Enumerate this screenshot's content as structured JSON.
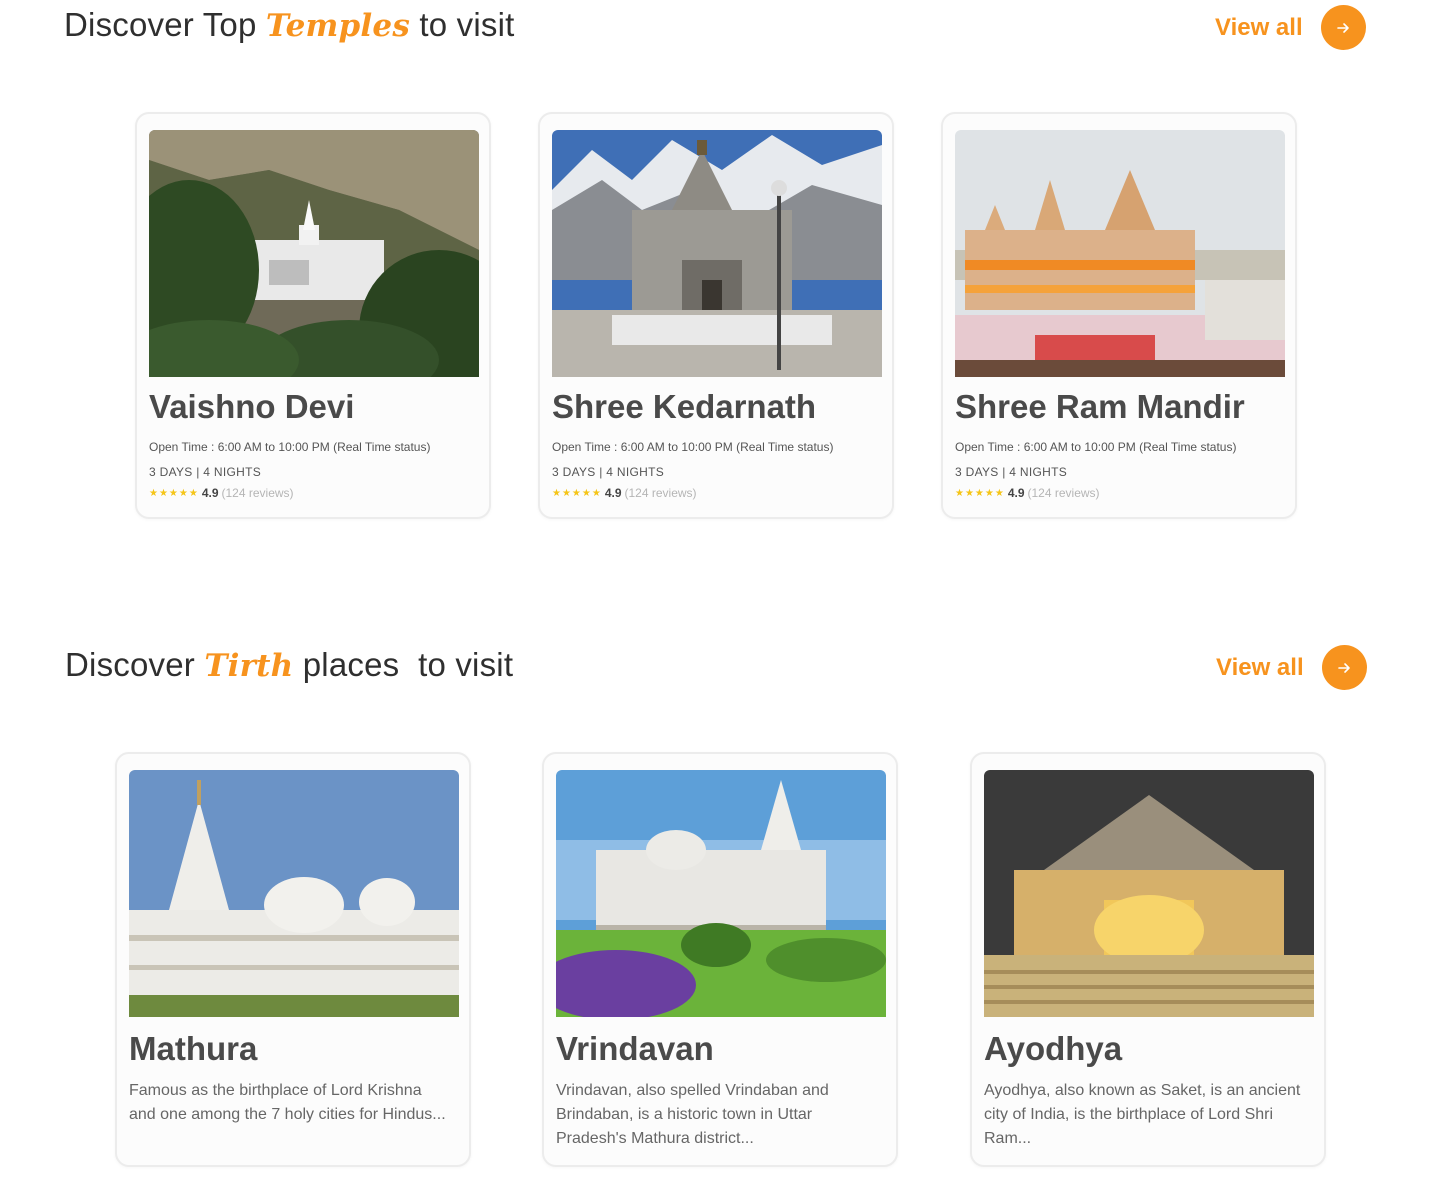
{
  "temples": {
    "title_prefix": "Discover Top ",
    "title_accent": "Temples",
    "title_suffix": " to visit",
    "view_all": "View all",
    "cards": [
      {
        "name": "Vaishno Devi",
        "open_time": "Open Time : 6:00 AM to 10:00 PM (Real Time status)",
        "duration": "3 DAYS | 4 NIGHTS",
        "stars": "★★★★★",
        "rating": "4.9",
        "reviews": "(124 reviews)"
      },
      {
        "name": "Shree Kedarnath",
        "open_time": "Open Time : 6:00 AM to 10:00 PM (Real Time status)",
        "duration": "3 DAYS | 4 NIGHTS",
        "stars": "★★★★★",
        "rating": "4.9",
        "reviews": "(124 reviews)"
      },
      {
        "name": "Shree Ram Mandir",
        "open_time": "Open Time : 6:00 AM to 10:00 PM (Real Time status)",
        "duration": "3 DAYS | 4 NIGHTS",
        "stars": "★★★★★",
        "rating": "4.9",
        "reviews": "(124 reviews)"
      }
    ]
  },
  "tirth": {
    "title_prefix": "Discover ",
    "title_accent": "Tirth",
    "title_suffix": " places  to visit",
    "view_all": "View all",
    "cards": [
      {
        "name": "Mathura",
        "description": "Famous as the birthplace of Lord Krishna and one among the 7 holy cities for Hindus..."
      },
      {
        "name": "Vrindavan",
        "description": "Vrindavan, also spelled Vrindaban and Brindaban, is a historic town in Uttar Pradesh's Mathura district..."
      },
      {
        "name": "Ayodhya",
        "description": "Ayodhya, also known as Saket, is an ancient city of India, is the birthplace of Lord Shri Ram..."
      }
    ]
  },
  "colors": {
    "accent": "#f7931e",
    "star": "#f5c518"
  },
  "icons": {
    "view_all": "arrow-right-icon",
    "rating": "star-icon"
  }
}
